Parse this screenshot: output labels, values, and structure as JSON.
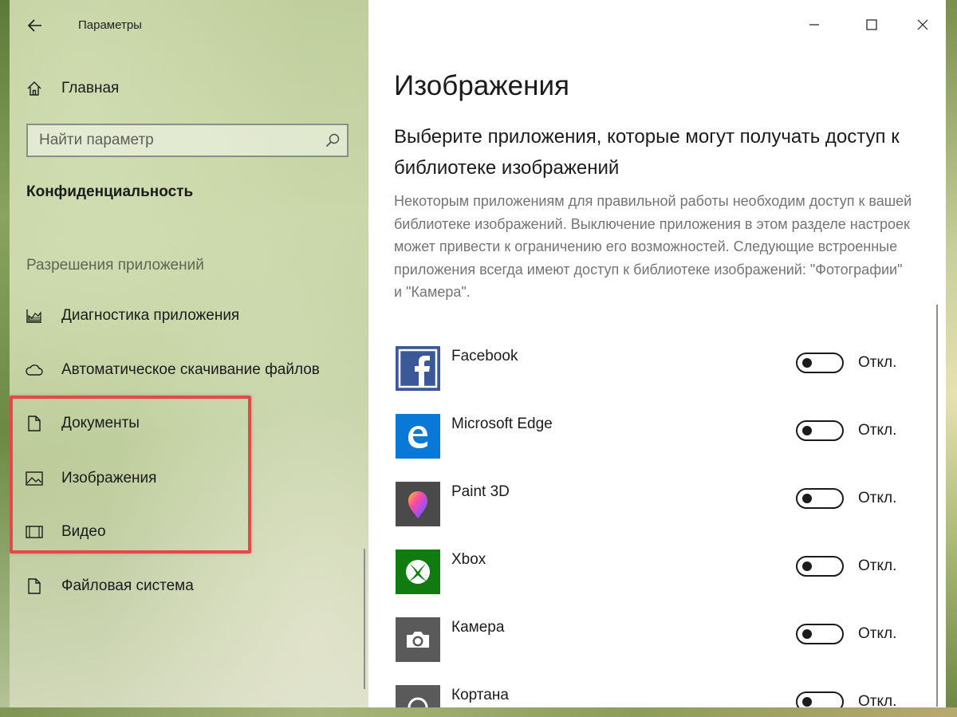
{
  "window": {
    "title": "Параметры",
    "controls": [
      "minimize",
      "maximize",
      "close"
    ]
  },
  "sidebar": {
    "home_label": "Главная",
    "search_placeholder": "Найти параметр",
    "section_title": "Конфиденциальность",
    "group_label": "Разрешения приложений",
    "items": [
      {
        "label": "Диагностика приложения",
        "icon": "chart-icon"
      },
      {
        "label": "Автоматическое скачивание файлов",
        "icon": "cloud-icon"
      },
      {
        "label": "Документы",
        "icon": "document-icon"
      },
      {
        "label": "Изображения",
        "icon": "image-icon"
      },
      {
        "label": "Видео",
        "icon": "video-icon"
      },
      {
        "label": "Файловая система",
        "icon": "document-icon"
      }
    ],
    "highlight_color": "#e24a4a"
  },
  "main": {
    "title": "Изображения",
    "subheading": "Выберите приложения, которые могут получать доступ к библиотеке изображений",
    "description": "Некоторым приложениям для правильной работы необходим доступ к вашей библиотеке изображений. Выключение приложения в этом разделе настроек может привести к ограничению его возможностей. Следующие встроенные приложения всегда имеют доступ к библиотеке изображений: \"Фотографии\" и \"Камера\".",
    "apps": [
      {
        "name": "Facebook",
        "state": "Откл.",
        "icon": "facebook-icon",
        "color": "#3b5998"
      },
      {
        "name": "Microsoft Edge",
        "state": "Откл.",
        "icon": "edge-icon",
        "color": "#0a78d7"
      },
      {
        "name": "Paint 3D",
        "state": "Откл.",
        "icon": "paint3d-icon",
        "color": "#4a4a4a"
      },
      {
        "name": "Xbox",
        "state": "Откл.",
        "icon": "xbox-icon",
        "color": "#107c10"
      },
      {
        "name": "Камера",
        "state": "Откл.",
        "icon": "camera-icon",
        "color": "#5a5a5a"
      },
      {
        "name": "Кортана",
        "state": "Откл.",
        "icon": "cortana-icon",
        "color": "#5a5a5a"
      }
    ]
  }
}
